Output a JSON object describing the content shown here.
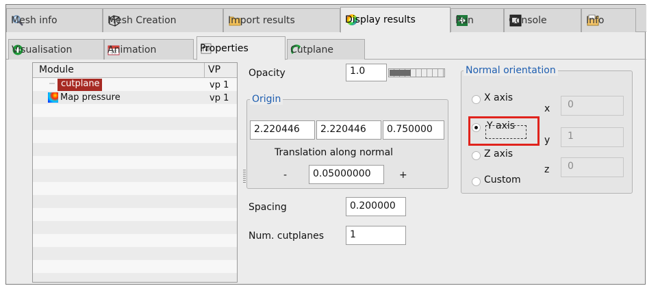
{
  "top_tabs": [
    {
      "label": "Mesh info",
      "icon": "magnifier-icon"
    },
    {
      "label": "Mesh Creation",
      "icon": "cube-icon"
    },
    {
      "label": "Import results",
      "icon": "folder-icon"
    },
    {
      "label": "Display results",
      "icon": "color-wheel-icon"
    },
    {
      "label": "Run",
      "icon": "arrow-right-icon"
    },
    {
      "label": "Console",
      "icon": "console-icon"
    },
    {
      "label": "Info",
      "icon": "info-icon"
    }
  ],
  "sub_tabs": [
    {
      "label": "Visualisation",
      "icon": "plus-icon"
    },
    {
      "label": "Animation",
      "icon": "calendar-icon"
    },
    {
      "label": "Properties",
      "icon": "properties-icon"
    },
    {
      "label": "Cutplane",
      "icon": "cutplane-icon"
    }
  ],
  "module_list": {
    "col_module": "Module",
    "col_vp": "VP",
    "rows": [
      {
        "name": "cutplane",
        "vp": "vp 1",
        "selected": true
      },
      {
        "name": "Map pressure",
        "vp": "vp 1",
        "selected": false
      }
    ]
  },
  "properties": {
    "opacity_label": "Opacity",
    "opacity_value": "1.0",
    "origin": {
      "title": "Origin",
      "x": "2.220446",
      "y": "2.220446",
      "z": "0.750000",
      "translation_label": "Translation along normal",
      "minus": "-",
      "plus": "+",
      "step": "0.05000000"
    },
    "spacing_label": "Spacing",
    "spacing_value": "0.200000",
    "num_label": "Num. cutplanes",
    "num_value": "1"
  },
  "normal": {
    "title": "Normal orientation",
    "options": [
      "X axis",
      "Y axis",
      "Z axis",
      "Custom"
    ],
    "selected": "Y axis",
    "x_label": "x",
    "x_value": "0",
    "y_label": "y",
    "y_value": "1",
    "z_label": "z",
    "z_value": "0"
  },
  "colors": {
    "accent": "#1e5eb0",
    "selection": "#a72a23",
    "highlight": "#e0231c"
  }
}
